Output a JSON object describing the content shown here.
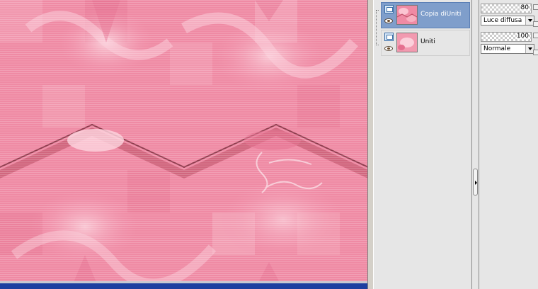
{
  "canvas": {
    "colors": {
      "base": "#f08aa5",
      "light": "#fbc5d2",
      "dark": "#d8607e",
      "watermark": "#ffffff"
    }
  },
  "layers_panel": {
    "layers": [
      {
        "name": "Copia diUniti",
        "selected": true,
        "visible": true,
        "icon": "raster-layer-icon"
      },
      {
        "name": "Uniti",
        "selected": false,
        "visible": true,
        "icon": "raster-layer-icon"
      }
    ]
  },
  "properties": {
    "opacity_top": "80",
    "blend_top": "Luce diffusa",
    "opacity_bottom": "100",
    "blend_bottom": "Normale"
  }
}
